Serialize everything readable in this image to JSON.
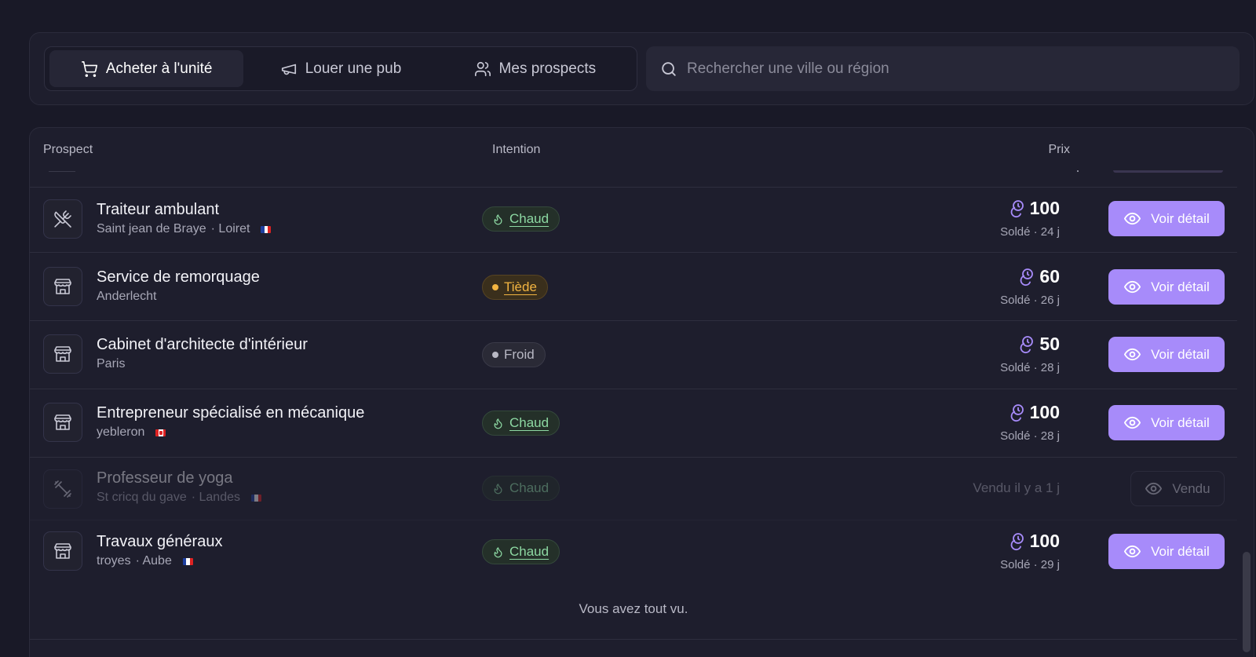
{
  "tabs": [
    {
      "label": "Acheter à l'unité",
      "icon": "cart-icon",
      "active": true
    },
    {
      "label": "Louer une pub",
      "icon": "megaphone-icon",
      "active": false
    },
    {
      "label": "Mes prospects",
      "icon": "users-icon",
      "active": false
    }
  ],
  "search": {
    "placeholder": "Rechercher une ville ou région",
    "value": ""
  },
  "table": {
    "headers": {
      "prospect": "Prospect",
      "intention": "Intention",
      "prix": "Prix"
    },
    "rows": [
      {
        "title": "Traiteur ambulant",
        "city": "Saint jean de Braye",
        "region": "· Loiret",
        "flag": "fr",
        "icon": "utensils-crossed-icon",
        "intention": "Chaud",
        "intention_level": "hot",
        "price": "100",
        "price_sub": "Soldé · 24 j",
        "action": "Voir détail",
        "sold": false
      },
      {
        "title": "Service de remorquage",
        "city": "Anderlecht",
        "region": "",
        "flag": "",
        "icon": "store-icon",
        "intention": "Tiède",
        "intention_level": "warm",
        "price": "60",
        "price_sub": "Soldé · 26 j",
        "action": "Voir détail",
        "sold": false
      },
      {
        "title": "Cabinet d'architecte d'intérieur",
        "city": "Paris",
        "region": "",
        "flag": "",
        "icon": "store-icon",
        "intention": "Froid",
        "intention_level": "cold",
        "price": "50",
        "price_sub": "Soldé · 28 j",
        "action": "Voir détail",
        "sold": false
      },
      {
        "title": "Entrepreneur spécialisé en mécanique",
        "city": "yebleron",
        "region": "",
        "flag": "ca",
        "icon": "store-icon",
        "intention": "Chaud",
        "intention_level": "hot",
        "price": "100",
        "price_sub": "Soldé · 28 j",
        "action": "Voir détail",
        "sold": false
      },
      {
        "title": "Professeur de yoga",
        "city": "St cricq du gave",
        "region": "· Landes",
        "flag": "fr",
        "icon": "dumbbell-icon",
        "intention": "Chaud",
        "intention_level": "hot",
        "sold_text": "Vendu il y a 1 j",
        "action": "Vendu",
        "sold": true
      },
      {
        "title": "Travaux généraux",
        "city": "troyes",
        "region": "· Aube",
        "flag": "fr",
        "icon": "store-icon",
        "intention": "Chaud",
        "intention_level": "hot",
        "price": "100",
        "price_sub": "Soldé · 29 j",
        "action": "Voir détail",
        "sold": false
      }
    ],
    "footer": "Vous avez tout vu."
  },
  "colors": {
    "accent": "#a78bfa",
    "hot": "#8dd9a3",
    "warm": "#f2b441",
    "cold": "#b8b8c4",
    "background": "#191927"
  }
}
